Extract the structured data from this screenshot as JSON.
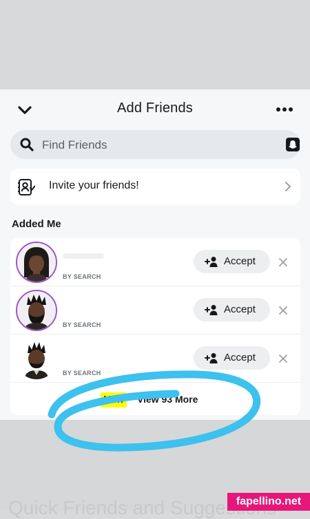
{
  "header": {
    "title": "Add Friends"
  },
  "search": {
    "placeholder": "Find Friends"
  },
  "invite": {
    "label": "Invite your friends!"
  },
  "section": {
    "title": "Added Me"
  },
  "requests": [
    {
      "subtitle": "BY SEARCH",
      "accept_label": "Accept"
    },
    {
      "subtitle": "BY SEARCH",
      "accept_label": "Accept"
    },
    {
      "subtitle": "BY SEARCH",
      "accept_label": "Accept"
    }
  ],
  "view_more": {
    "badge": "New",
    "label": "View 93 More"
  },
  "background_text": "Quick Friends and Suggestions",
  "watermark": "fapellino.net",
  "colors": {
    "accent_yellow": "#fffc00",
    "story_ring": "#9b55c8",
    "annotation_blue": "#3dc1ee",
    "watermark_pink": "#e7167b"
  },
  "icons": [
    "chevron-down-icon",
    "more-icon",
    "search-icon",
    "snapcode-icon",
    "contacts-icon",
    "chevron-right-icon",
    "add-friend-icon",
    "close-icon"
  ]
}
